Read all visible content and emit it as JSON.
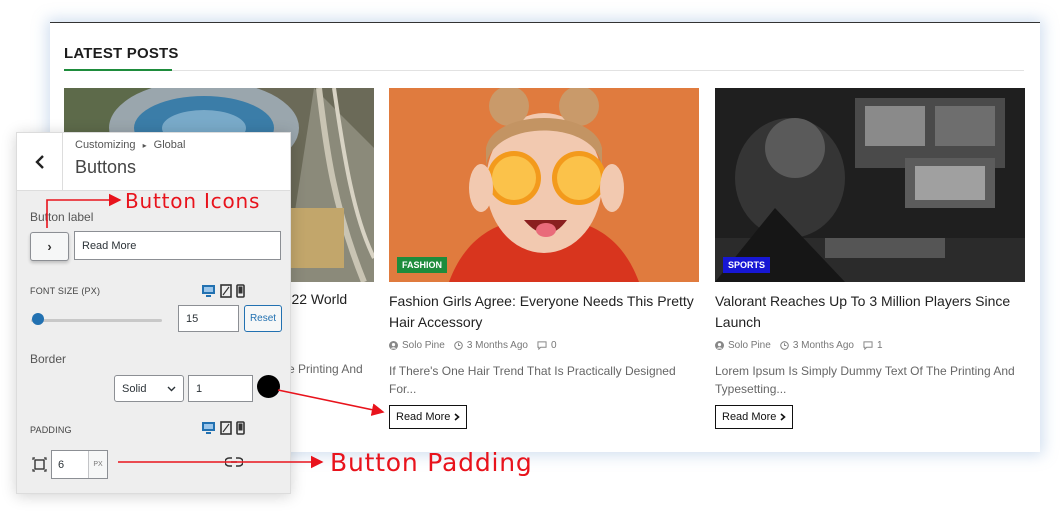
{
  "site": {
    "section_title": "LATEST POSTS",
    "posts": [
      {
        "category": "",
        "category_color": "",
        "title": "...022 World",
        "author": "",
        "date": "",
        "comments": "",
        "excerpt": "...e Printing And",
        "read_more": "Read More"
      },
      {
        "category": "FASHION",
        "category_color": "#1e8c3c",
        "title": "Fashion Girls Agree: Everyone Needs This Pretty Hair Accessory",
        "author": "Solo Pine",
        "date": "3 Months Ago",
        "comments": "0",
        "excerpt": "If There's One Hair Trend That Is Practically Designed For...",
        "read_more": "Read More"
      },
      {
        "category": "SPORTS",
        "category_color": "#1717d4",
        "title": "Valorant Reaches Up To 3 Million Players Since Launch",
        "author": "Solo Pine",
        "date": "3 Months Ago",
        "comments": "1",
        "excerpt": "Lorem Ipsum Is Simply Dummy Text Of The Printing And Typesetting...",
        "read_more": "Read More"
      }
    ]
  },
  "customizer": {
    "breadcrumb_root": "Customizing",
    "breadcrumb_sep": "▸",
    "breadcrumb_section": "Global",
    "title": "Buttons",
    "button_label_heading": "Button label",
    "button_icon_glyph": "›",
    "button_label_value": "Read More",
    "font_size_heading": "FONT SIZE (PX)",
    "font_size_value": "15",
    "font_size_slider_fraction": 0.02,
    "reset_label": "Reset",
    "border_heading": "Border",
    "border_style": "Solid",
    "border_width": "1",
    "border_color": "#000000",
    "padding_heading": "PADDING",
    "padding_value": "6",
    "padding_unit": "PX"
  },
  "annotations": {
    "button_icons": "Button Icons",
    "button_padding": "Button Padding"
  },
  "colors": {
    "accent_green": "#1e8c3c",
    "accent_blue": "#2271b1",
    "annotation_red": "#e8131c"
  }
}
